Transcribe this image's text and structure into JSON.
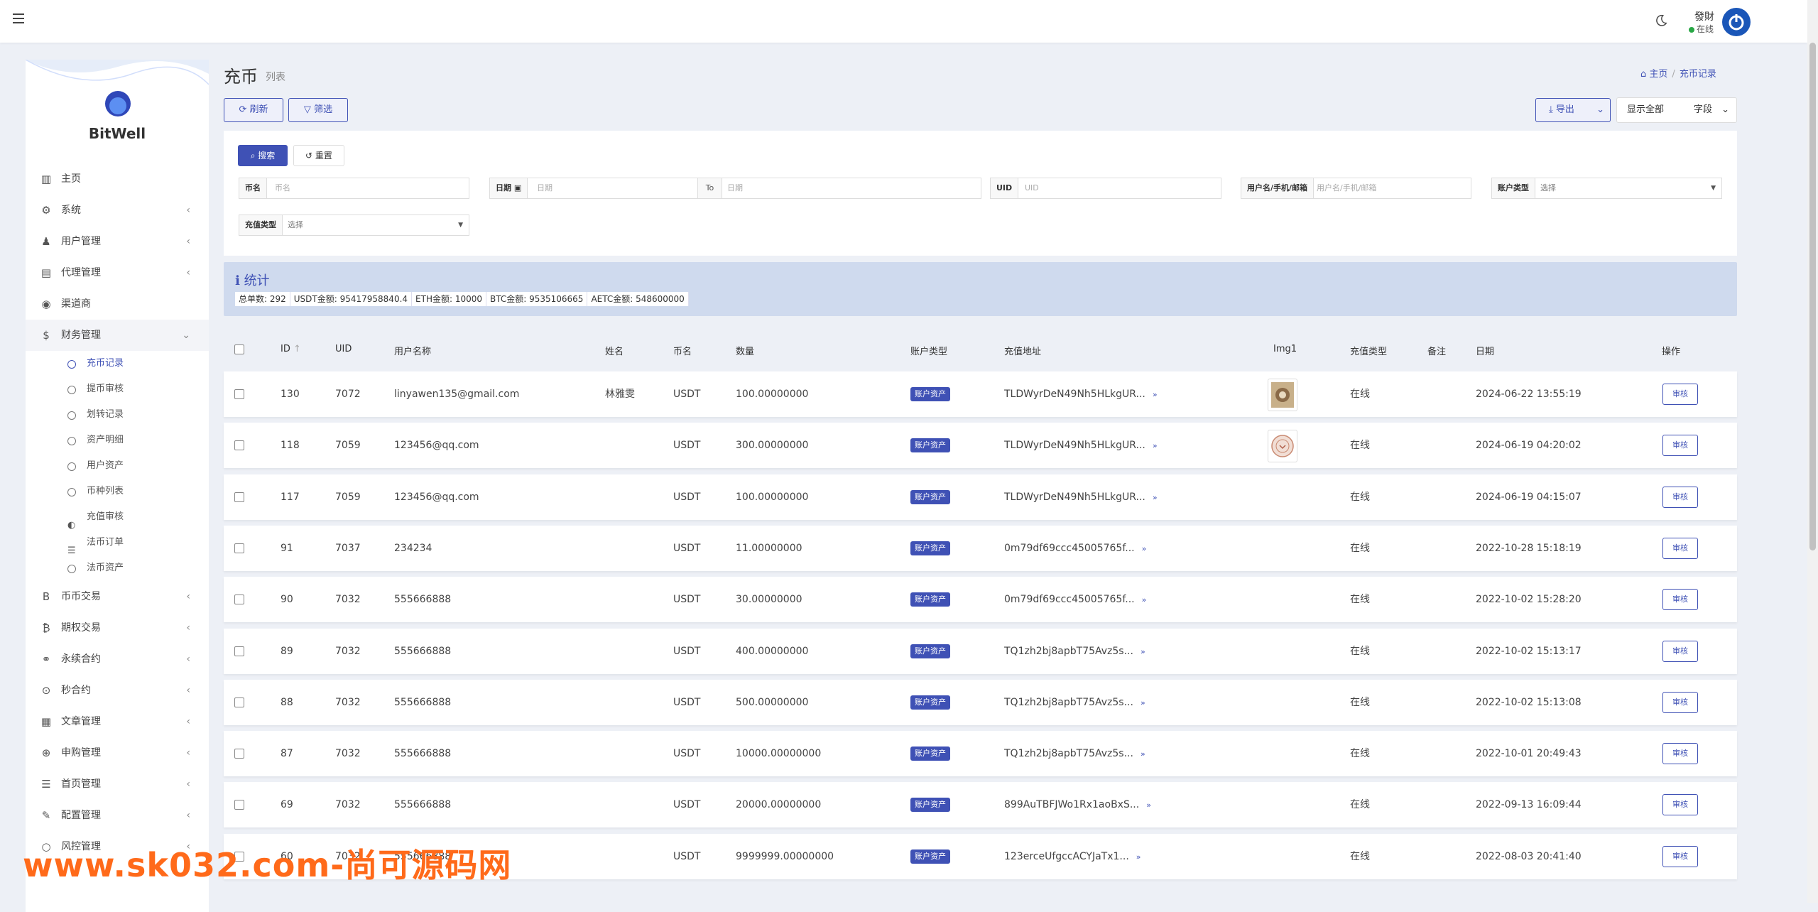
{
  "user": {
    "name": "發財",
    "status": "在线"
  },
  "brand": "BitWell",
  "nav": [
    {
      "label": "主页",
      "icon": "chart-icon",
      "glyph": "▥",
      "chevron": false
    },
    {
      "label": "系统",
      "icon": "gear-icon",
      "glyph": "⚙",
      "chevron": true
    },
    {
      "label": "用户管理",
      "icon": "users-icon",
      "glyph": "♟",
      "chevron": true
    },
    {
      "label": "代理管理",
      "icon": "id-card-icon",
      "glyph": "▤",
      "chevron": true
    },
    {
      "label": "渠道商",
      "icon": "user-circle-icon",
      "glyph": "◉",
      "chevron": false
    },
    {
      "label": "财务管理",
      "icon": "dollar-icon",
      "glyph": "$",
      "chevron": true,
      "open": true
    }
  ],
  "finance_sub": [
    {
      "label": "充币记录",
      "active": true
    },
    {
      "label": "提币审核"
    },
    {
      "label": "划转记录"
    },
    {
      "label": "资产明细"
    },
    {
      "label": "用户资产"
    },
    {
      "label": "币种列表"
    },
    {
      "label": "充值审核",
      "glyph": "◐"
    },
    {
      "label": "法币订单",
      "glyph": "☰"
    },
    {
      "label": "法币资产"
    }
  ],
  "nav2": [
    {
      "label": "币币交易",
      "icon": "bitcoin-b-icon",
      "glyph": "B"
    },
    {
      "label": "期权交易",
      "icon": "bitcoin-icon",
      "glyph": "₿"
    },
    {
      "label": "永续合约",
      "icon": "link-icon",
      "glyph": "⚭"
    },
    {
      "label": "秒合约",
      "icon": "dot-circle-icon",
      "glyph": "⊙"
    },
    {
      "label": "文章管理",
      "icon": "newspaper-icon",
      "glyph": "▦"
    },
    {
      "label": "申购管理",
      "icon": "globe-icon",
      "glyph": "⊕"
    },
    {
      "label": "首页管理",
      "icon": "list-icon",
      "glyph": "☰"
    },
    {
      "label": "配置管理",
      "icon": "wrench-icon",
      "glyph": "✎"
    },
    {
      "label": "风控管理",
      "icon": "circle-icon",
      "glyph": "○"
    }
  ],
  "page": {
    "title": "充币",
    "subtitle": "列表"
  },
  "breadcrumb": {
    "home": "主页",
    "current": "充币记录"
  },
  "toolbar": {
    "refresh": "刷新",
    "filter": "筛选",
    "export": "导出",
    "show_all": "显示全部",
    "fields": "字段"
  },
  "filters": {
    "search": "搜索",
    "reset": "重置",
    "coin_label": "币名",
    "coin_placeholder": "币名",
    "date_label": "日期",
    "date_from_placeholder": "日期",
    "date_to": "To",
    "date_to_placeholder": "日期",
    "uid_label": "UID",
    "uid_placeholder": "UID",
    "user_label": "用户名/手机/邮箱",
    "user_placeholder": "用户名/手机/邮箱",
    "account_label": "账户类型",
    "account_value": "选择",
    "recharge_label": "充值类型",
    "recharge_value": "选择"
  },
  "stats": {
    "title": "统计",
    "items": [
      "总单数: 292",
      "USDT金额: 95417958840.4",
      "ETH金额: 10000",
      "BTC金额: 9535106665",
      "AETC金额: 548600000"
    ]
  },
  "columns": [
    "ID",
    "UID",
    "用户名称",
    "姓名",
    "币名",
    "数量",
    "账户类型",
    "充值地址",
    "Img1",
    "充值类型",
    "备注",
    "日期",
    "操作"
  ],
  "rows": [
    {
      "id": "130",
      "uid": "7072",
      "user": "linyawen135@gmail.com",
      "name": "林雅雯",
      "coin": "USDT",
      "qty": "100.00000000",
      "account": "账户资产",
      "addr": "TLDWyrDeN49Nh5HLkgUR...",
      "img": "photo",
      "type": "在线",
      "date": "2024-06-22 13:55:19",
      "action": "审核"
    },
    {
      "id": "118",
      "uid": "7059",
      "user": "123456@qq.com",
      "name": "",
      "coin": "USDT",
      "qty": "300.00000000",
      "account": "账户资产",
      "addr": "TLDWyrDeN49Nh5HLkgUR...",
      "img": "seal",
      "type": "在线",
      "date": "2024-06-19 04:20:02",
      "action": "审核"
    },
    {
      "id": "117",
      "uid": "7059",
      "user": "123456@qq.com",
      "name": "",
      "coin": "USDT",
      "qty": "100.00000000",
      "account": "账户资产",
      "addr": "TLDWyrDeN49Nh5HLkgUR...",
      "img": "",
      "type": "在线",
      "date": "2024-06-19 04:15:07",
      "action": "审核"
    },
    {
      "id": "91",
      "uid": "7037",
      "user": "234234",
      "name": "",
      "coin": "USDT",
      "qty": "11.00000000",
      "account": "账户资产",
      "addr": "0m79df69ccc45005765f...",
      "img": "",
      "type": "在线",
      "date": "2022-10-28 15:18:19",
      "action": "审核"
    },
    {
      "id": "90",
      "uid": "7032",
      "user": "555666888",
      "name": "",
      "coin": "USDT",
      "qty": "30.00000000",
      "account": "账户资产",
      "addr": "0m79df69ccc45005765f...",
      "img": "",
      "type": "在线",
      "date": "2022-10-02 15:28:20",
      "action": "审核"
    },
    {
      "id": "89",
      "uid": "7032",
      "user": "555666888",
      "name": "",
      "coin": "USDT",
      "qty": "400.00000000",
      "account": "账户资产",
      "addr": "TQ1zh2bj8apbT75Avz5s...",
      "img": "",
      "type": "在线",
      "date": "2022-10-02 15:13:17",
      "action": "审核"
    },
    {
      "id": "88",
      "uid": "7032",
      "user": "555666888",
      "name": "",
      "coin": "USDT",
      "qty": "500.00000000",
      "account": "账户资产",
      "addr": "TQ1zh2bj8apbT75Avz5s...",
      "img": "",
      "type": "在线",
      "date": "2022-10-02 15:13:08",
      "action": "审核"
    },
    {
      "id": "87",
      "uid": "7032",
      "user": "555666888",
      "name": "",
      "coin": "USDT",
      "qty": "10000.00000000",
      "account": "账户资产",
      "addr": "TQ1zh2bj8apbT75Avz5s...",
      "img": "",
      "type": "在线",
      "date": "2022-10-01 20:49:43",
      "action": "审核"
    },
    {
      "id": "69",
      "uid": "7032",
      "user": "555666888",
      "name": "",
      "coin": "USDT",
      "qty": "20000.00000000",
      "account": "账户资产",
      "addr": "899AuTBFJWo1Rx1aoBxS...",
      "img": "",
      "type": "在线",
      "date": "2022-09-13 16:09:44",
      "action": "审核"
    },
    {
      "id": "60",
      "uid": "7032",
      "user": "555666888",
      "name": "",
      "coin": "USDT",
      "qty": "9999999.00000000",
      "account": "账户资产",
      "addr": "123erceUfgccACYJaTx1...",
      "img": "",
      "type": "在线",
      "date": "2022-08-03 20:41:40",
      "action": "审核"
    }
  ],
  "watermark": "www.sk032.com-尚可源码网",
  "colors": {
    "primary": "#3f51b5",
    "accent_orange": "#ff6a1a",
    "online": "#28a745"
  }
}
